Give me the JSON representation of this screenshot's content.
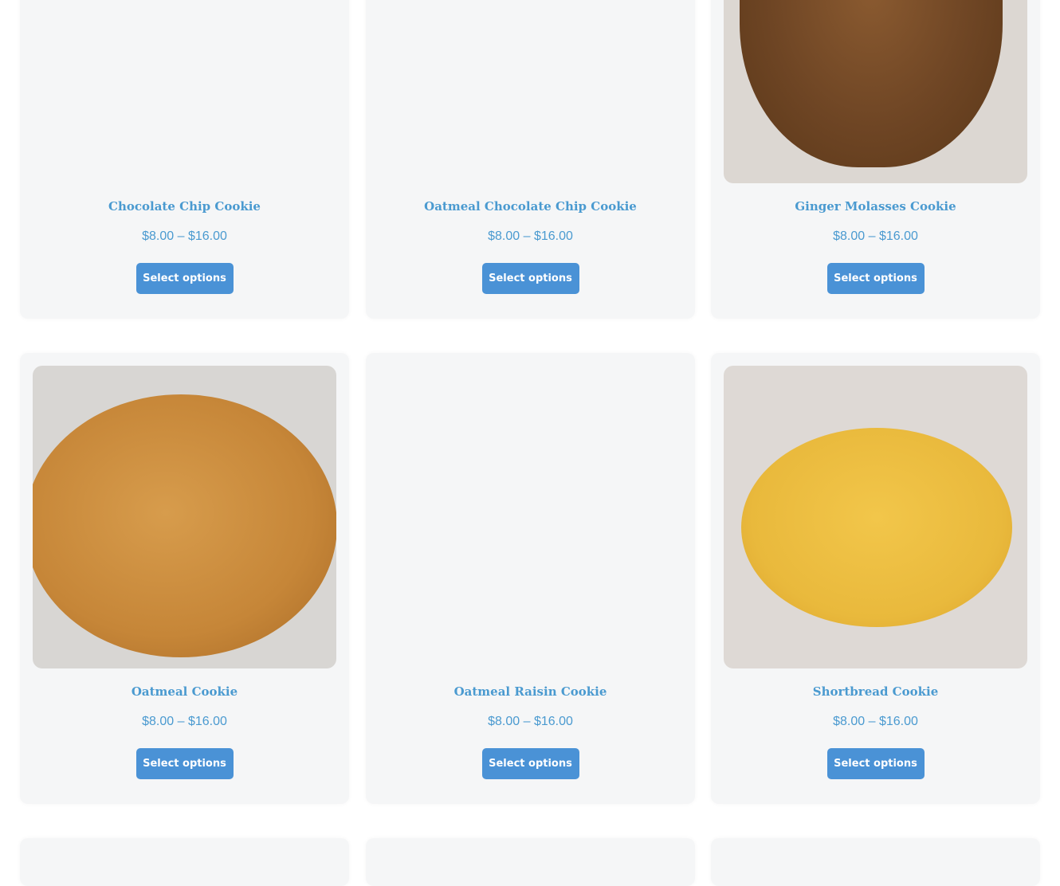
{
  "products": [
    {
      "name": "Chocolate Chip Cookie",
      "price": "$8.00 – $16.00",
      "button": "Select options",
      "image": "none"
    },
    {
      "name": "Oatmeal Chocolate Chip Cookie",
      "price": "$8.00 – $16.00",
      "button": "Select options",
      "image": "none"
    },
    {
      "name": "Ginger Molasses Cookie",
      "price": "$8.00 – $16.00",
      "button": "Select options",
      "image": "ginger-molasses-cookie-photo"
    },
    {
      "name": "Oatmeal Cookie",
      "price": "$8.00 – $16.00",
      "button": "Select options",
      "image": "oatmeal-cookie-photo"
    },
    {
      "name": "Oatmeal Raisin Cookie",
      "price": "$8.00 – $16.00",
      "button": "Select options",
      "image": "none"
    },
    {
      "name": "Shortbread Cookie",
      "price": "$8.00 – $16.00",
      "button": "Select options",
      "image": "shortbread-cookie-photo"
    }
  ],
  "colors": {
    "accent": "#4a9ad0",
    "button": "#4a92d6",
    "card": "#f5f6f7"
  }
}
